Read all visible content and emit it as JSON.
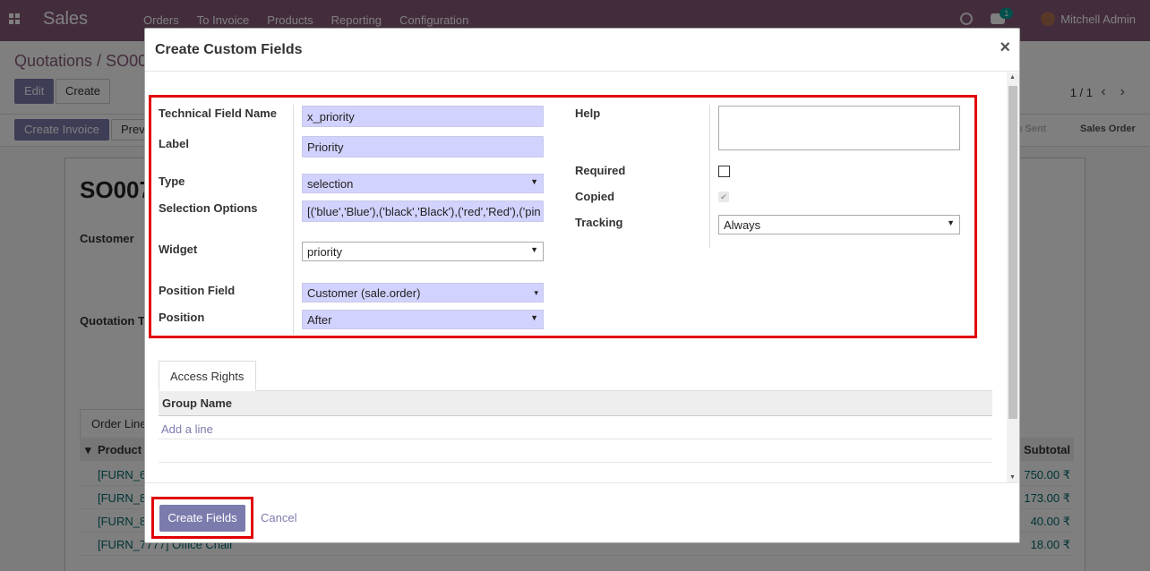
{
  "navbar": {
    "app_name": "Sales",
    "menu": [
      "Orders",
      "To Invoice",
      "Products",
      "Reporting",
      "Configuration"
    ],
    "chat_badge": "1",
    "user": "Mitchell Admin"
  },
  "control_panel": {
    "breadcrumb": "Quotations / SO00",
    "edit_label": "Edit",
    "create_label": "Create",
    "pager": "1 / 1"
  },
  "statusbar": {
    "create_invoice_label": "Create Invoice",
    "preview_label": "Previ",
    "stage_sent": "on Sent",
    "stage_order": "Sales Order"
  },
  "sheet": {
    "title": "SO007",
    "customer_label": "Customer",
    "quotation_label": "Quotation T",
    "order_lines_tab": "Order Line",
    "product_header": "Product",
    "subtotal_header": "Subtotal",
    "rows": [
      {
        "product": "[FURN_6",
        "subtotal": "750.00 ₹"
      },
      {
        "product": "[FURN_8",
        "subtotal": "173.00 ₹"
      },
      {
        "product": "[FURN_8",
        "subtotal": "40.00 ₹"
      },
      {
        "product": "[FURN_7777] Office Chair",
        "subtotal": "18.00 ₹"
      }
    ]
  },
  "modal": {
    "title": "Create Custom Fields",
    "close_symbol": "×",
    "fields": {
      "technical_name_label": "Technical Field Name",
      "technical_name_value": "x_priority",
      "label_label": "Label",
      "label_value": "Priority",
      "type_label": "Type",
      "type_value": "selection",
      "selection_options_label": "Selection Options",
      "selection_options_value": "[('blue','Blue'),('black','Black'),('red','Red'),('pin",
      "widget_label": "Widget",
      "widget_value": "priority",
      "position_field_label": "Position Field",
      "position_field_value": "Customer (sale.order)",
      "position_label": "Position",
      "position_value": "After",
      "help_label": "Help",
      "required_label": "Required",
      "copied_label": "Copied",
      "tracking_label": "Tracking",
      "tracking_value": "Always"
    },
    "access_rights_tab": "Access Rights",
    "group_name_header": "Group Name",
    "add_line": "Add a line",
    "create_fields_label": "Create Fields",
    "cancel_label": "Cancel"
  },
  "colors": {
    "navbar": "#875a7b",
    "primary": "#7c7bad",
    "highlight": "#e00000",
    "required_field": "#d2d2ff"
  }
}
